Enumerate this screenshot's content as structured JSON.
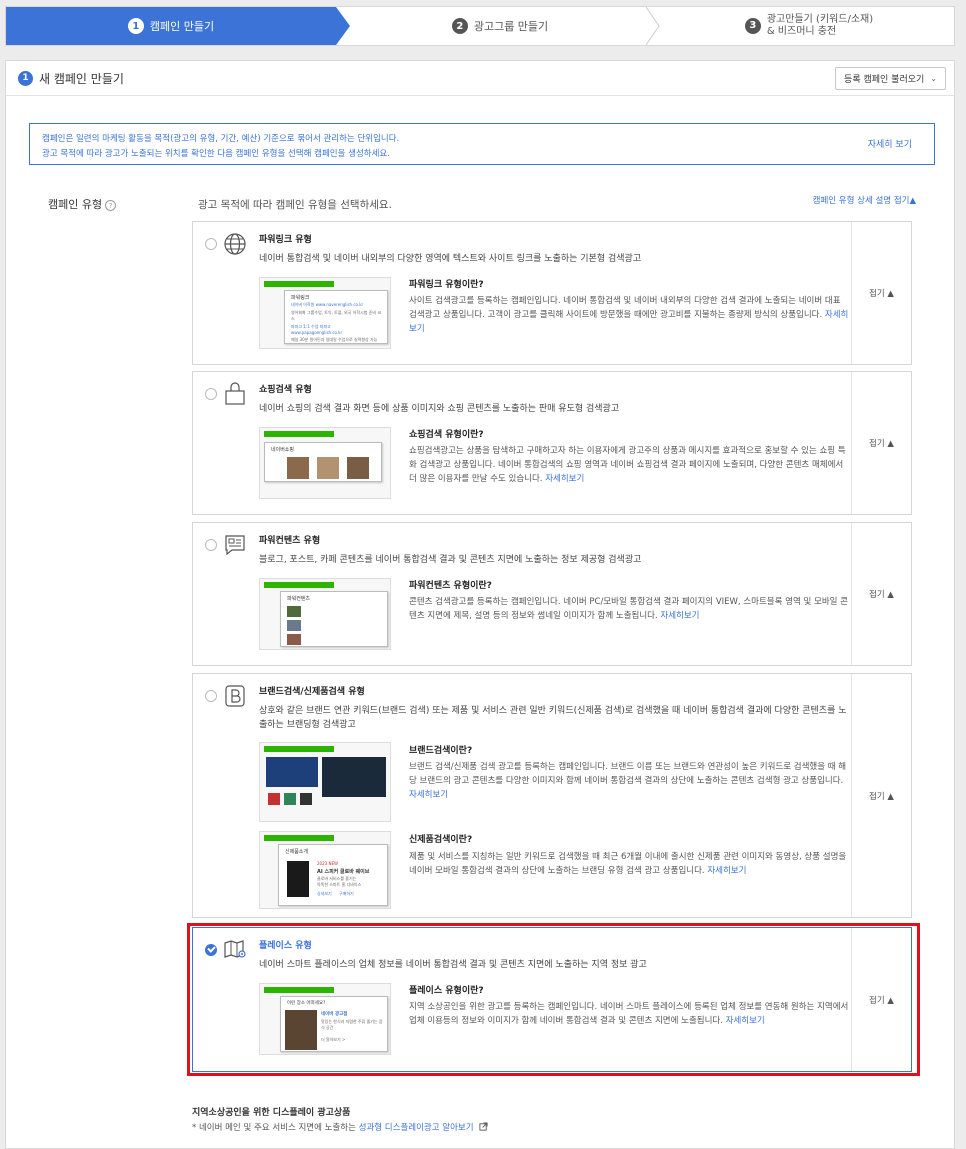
{
  "stepper": {
    "steps": [
      {
        "num": "1",
        "label": "캠페인 만들기"
      },
      {
        "num": "2",
        "label": "광고그룹 만들기"
      },
      {
        "num": "3",
        "label_line1": "광고만들기 (키워드/소재)",
        "label_line2": "& 비즈머니 충전"
      }
    ]
  },
  "panel": {
    "header_num": "1",
    "header_title": "새 캠페인 만들기",
    "load_button": "등록 캠페인 불러오기",
    "info_line1": "캠페인은 일련의 마케팅 활동을 목적(광고의 유형, 기간, 예산) 기준으로 묶어서 관리하는 단위입니다.",
    "info_line2": "광고 목적에 따라 광고가 노출되는 위치를 확인한 다음 캠페인 유형을 선택해 캠페인을 생성하세요.",
    "info_more": "자세히 보기",
    "type_label": "캠페인 유형",
    "type_prompt": "광고 목적에 따라 캠페인 유형을 선택하세요.",
    "type_toggle": "캠페인 유형 상세 설명 접기▲"
  },
  "fold_label": "접기 ▲",
  "more_link": "자세히보기",
  "cards": [
    {
      "title": "파워링크 유형",
      "desc": "네이버 통합검색 및 네이버 내외부의 다양한 영역에 텍스트와 사이트 링크를 노출하는 기본형 검색광고",
      "sub_title": "파워링크 유형이란?",
      "sub_desc": "사이트 검색광고를 등록하는 캠페인입니다. 네이버 통합검색 및 네이버 내외부의 다양한 검색 결과에 노출되는 네이버 대표 검색광고 상품입니다. 고객이 광고를 클릭해 사이트에 방문했을 때에만 광고비를 지불하는 종량제 방식의 상품입니다.",
      "icon": "globe-icon"
    },
    {
      "title": "쇼핑검색 유형",
      "desc": "네이버 쇼핑의 검색 결과 화면 등에 상품 이미지와 쇼핑 콘텐츠를 노출하는 판매 유도형 검색광고",
      "sub_title": "쇼핑검색 유형이란?",
      "sub_desc": "쇼핑검색광고는 상품을 탐색하고 구매하고자 하는 이용자에게 광고주의 상품과 메시지를 효과적으로 홍보할 수 있는 쇼핑 특화 검색광고 상품입니다. 네이버 통합검색의 쇼핑 영역과 네이버 쇼핑검색 결과 페이지에 노출되며, 다양한 콘텐츠 매체에서 더 많은 이용자를 만날 수도 있습니다.",
      "icon": "shopping-bag-icon"
    },
    {
      "title": "파워컨텐츠 유형",
      "desc": "블로그, 포스트, 카페 콘텐츠를 네이버 통합검색 결과 및 콘텐츠 지면에 노출하는 정보 제공형 검색광고",
      "sub_title": "파워컨텐츠 유형이란?",
      "sub_desc": "콘텐츠 검색광고를 등록하는 캠페인입니다. 네이버 PC/모바일 통합검색 결과 페이지의 VIEW, 스마트블록 영역 및 모바일 콘텐츠 지면에 제목, 설명 등의 정보와 썸네일 이미지가 함께 노출됩니다.",
      "icon": "content-icon"
    },
    {
      "title": "브랜드검색/신제품검색 유형",
      "desc": "상호와 같은 브랜드 연관 키워드(브랜드 검색) 또는 제품 및 서비스 관련 일반 키워드(신제품 검색)로 검색했을 때 네이버 통합검색 결과에 다양한 콘텐츠를 노출하는 브랜딩형 검색광고",
      "sub_title": "브랜드검색이란?",
      "sub_desc": "브랜드 검색/신제품 검색 광고를 등록하는 캠페인입니다. 브랜드 이름 또는 브랜드와 연관성이 높은 키워드로 검색했을 때 해당 브랜드의 광고 콘텐츠를 다양한 이미지와 함께 네이버 통합검색 결과의 상단에 노출하는 콘텐츠 검색형 광고 상품입니다.",
      "sub_title2": "신제품검색이란?",
      "sub_desc2": "제품 및 서비스를 지칭하는 일반 키워드로 검색했을 때 최근 6개월 이내에 출시한 신제품 관련 이미지와 동영상, 상품 설명을 네이버 모바일 통합검색 결과의 상단에 노출하는 브랜딩 유형 검색 광고 상품입니다.",
      "icon": "brand-b-icon"
    },
    {
      "title": "플레이스 유형",
      "desc": "네이버 스마트 플레이스의 업체 정보를 네이버 통합검색 결과 및 콘텐츠 지면에 노출하는 지역 정보 광고",
      "sub_title": "플레이스 유형이란?",
      "sub_desc": "지역 소상공인을 위한 광고를 등록하는 캠페인입니다. 네이버 스마트 플레이스에 등록된 업체 정보를 연동해 원하는 지역에서 업체 이용등의 정보와 이미지가 함께 네이버 통합검색 결과 및 콘텐츠 지면에 노출됩니다.",
      "icon": "map-pin-icon"
    }
  ],
  "thumbs": {
    "powerlink": {
      "brand": "NAVER",
      "head": "파워링크",
      "ad1": "네이버 어학원 www.naverenglish.co.kr",
      "ad2": "영어회화 그룹수업, 토익, 토플, 외국 어학시험 준비 코스",
      "ad3": "파파고 1:1 수업 파파고 www.papagoenglish.co.kr",
      "ad4": "매일 30분 원어민과 일대일 수업으로 실력향상 가능"
    },
    "shopping": {
      "head": "네이버쇼핑"
    },
    "content": {
      "head": "파워컨텐츠"
    },
    "newprod": {
      "head": "신제품소개",
      "tag": "2023 NEW",
      "name": "AI 스피커 클로바 웨이브",
      "sub": "클로바 서비스를 즐기는",
      "sub2": "똑똑한 스마트 홈 디바이스",
      "link1": "상세보기",
      "link2": "구매하기"
    },
    "place": {
      "head": "이런 장소 어떠세요?",
      "name": "네이버 광고점",
      "sub": "맛있는 한식과 저렴한 주류 즐기는 음식 공간",
      "more": "더 알아보기 >"
    }
  },
  "footer": {
    "title": "지역소상공인을 위한 디스플레이 광고상품",
    "desc_prefix": "* 네이버 메인 및 주요 서비스 지면에 노출하는 ",
    "desc_link": "성과형 디스플레이광고 알아보기"
  },
  "colors": {
    "accent": "#3b73d6",
    "naver_green": "#2db400",
    "highlight": "#e0111a"
  }
}
